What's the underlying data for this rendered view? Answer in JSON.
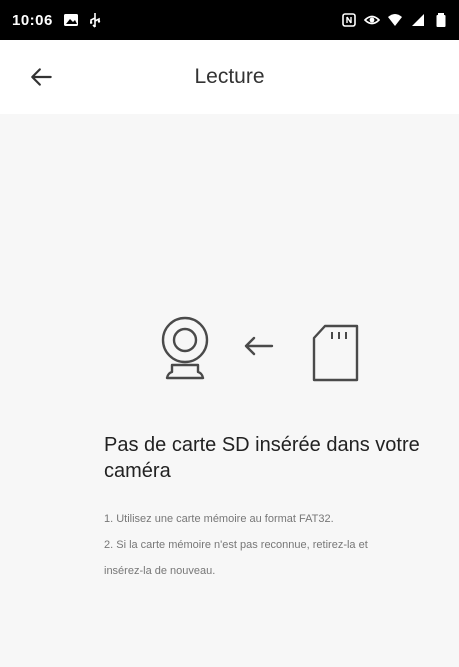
{
  "status_bar": {
    "time": "10:06",
    "left_icons": [
      "gallery-icon",
      "usb-icon"
    ],
    "right_icons": [
      "nfc-icon",
      "eye-icon",
      "wifi-icon",
      "signal-icon",
      "battery-icon"
    ]
  },
  "app_bar": {
    "title": "Lecture",
    "back_icon": "back-arrow-icon"
  },
  "empty_state": {
    "illustration": [
      "camera-icon",
      "left-arrow-icon",
      "sd-card-icon"
    ],
    "title": "Pas de carte SD insérée dans votre caméra",
    "tips": [
      "1. Utilisez une carte mémoire au format FAT32.",
      "2. Si la carte mémoire n'est pas reconnue, retirez-la et insérez-la de nouveau."
    ]
  },
  "colors": {
    "status_bar_bg": "#000000",
    "app_bar_bg": "#ffffff",
    "content_bg": "#f7f7f7",
    "illustration_stroke": "#4a4a4a"
  }
}
